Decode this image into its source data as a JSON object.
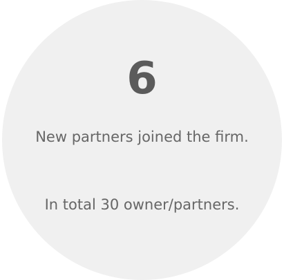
{
  "stat": {
    "number": "6",
    "description": "New partners joined the firm.",
    "total": "In total 30 owner/partners."
  },
  "colors": {
    "circle_background": "#f0f0f0",
    "number_text": "#5b5b5b",
    "body_text": "#666666"
  }
}
